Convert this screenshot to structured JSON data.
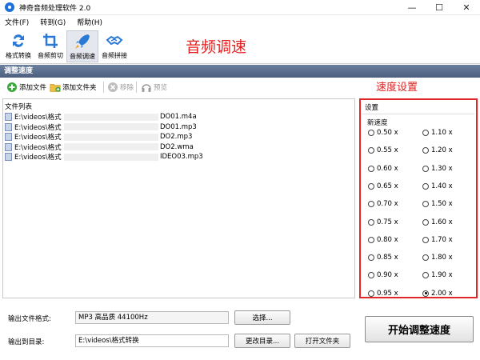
{
  "window": {
    "title": "神奇音频处理软件 2.0",
    "minimize": "—",
    "maximize": "☐",
    "close": "✕"
  },
  "menu": [
    "文件(F)",
    "转到(G)",
    "帮助(H)"
  ],
  "toolbar": [
    {
      "label": "格式转换",
      "icon": "format-convert-icon"
    },
    {
      "label": "音频剪切",
      "icon": "crop-icon"
    },
    {
      "label": "音频调速",
      "icon": "rocket-icon",
      "active": true
    },
    {
      "label": "音频拼接",
      "icon": "handshake-icon"
    }
  ],
  "annotations": {
    "speed": "音频调速",
    "settings": "速度设置"
  },
  "section_title": "调整速度",
  "subtoolbar": {
    "add_file": "添加文件",
    "add_folder": "添加文件夹",
    "remove": "移除",
    "preview": "预览"
  },
  "file_list": {
    "header": "文件列表",
    "rows": [
      {
        "prefix": "E:\\videos\\格式",
        "suffix": "DO01.m4a"
      },
      {
        "prefix": "E:\\videos\\格式",
        "suffix": "DO01.mp3"
      },
      {
        "prefix": "E:\\videos\\格式",
        "suffix": "DO2.mp3"
      },
      {
        "prefix": "E:\\videos\\格式",
        "suffix": "DO2.wma"
      },
      {
        "prefix": "E:\\videos\\格式",
        "suffix": "IDEO03.mp3"
      }
    ]
  },
  "settings": {
    "title": "设置",
    "subtitle": "新速度",
    "options_left": [
      "0.50 x",
      "0.55 x",
      "0.60 x",
      "0.65 x",
      "0.70 x",
      "0.75 x",
      "0.80 x",
      "0.85 x",
      "0.90 x",
      "0.95 x"
    ],
    "options_right": [
      "1.10 x",
      "1.20 x",
      "1.30 x",
      "1.40 x",
      "1.50 x",
      "1.60 x",
      "1.70 x",
      "1.80 x",
      "1.90 x",
      "2.00 x"
    ],
    "selected": "2.00 x"
  },
  "output": {
    "format_label": "输出文件格式:",
    "format_value": "MP3 高品质 44100Hz",
    "choose_button": "选择...",
    "dir_label": "输出到目录:",
    "dir_value": "E:\\videos\\格式转换",
    "change_dir_button": "更改目录...",
    "open_folder_button": "打开文件夹"
  },
  "start_button": "开始调整速度",
  "colors": {
    "annotation": "#e02020",
    "header_bar": "#56698a",
    "settings_border": "#e02828"
  }
}
